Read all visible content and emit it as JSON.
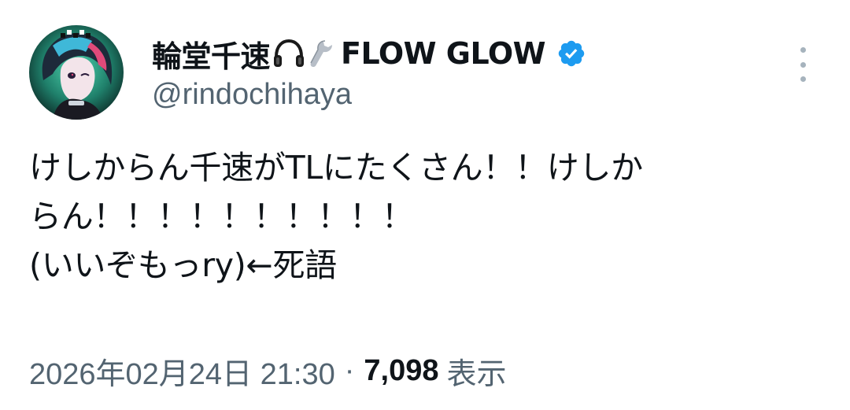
{
  "tweet": {
    "author": {
      "display_name": "輪堂千速",
      "name_suffix": "FLOW GLOW",
      "emoji_icons": [
        "headphones-icon",
        "wrench-icon"
      ],
      "verified_badge": "verified-badge-icon",
      "handle": "@rindochihaya"
    },
    "text_lines": [
      "けしからん千速がTLにたくさん！！けしか",
      "らん！！！！！！！！！！",
      "(いいぞもっry)←死語"
    ],
    "timestamp": "2026年02月24日 21:30",
    "separator": "·",
    "views_count": "7,098",
    "views_label": "表示",
    "more_icon": "more-vertical-icon"
  },
  "colors": {
    "text_primary": "#0f1419",
    "text_secondary": "#536471",
    "verified_blue": "#1d9bf0",
    "more_dots": "#a6b3bd"
  }
}
